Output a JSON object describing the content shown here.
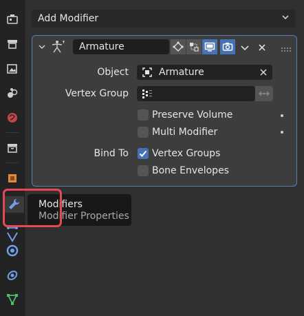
{
  "header": {
    "add_modifier_label": "Add Modifier"
  },
  "modifier": {
    "name": "Armature",
    "object_label": "Object",
    "object_value": "Armature",
    "vertex_group_label": "Vertex Group",
    "vertex_group_value": "",
    "preserve_volume_label": "Preserve Volume",
    "preserve_volume_checked": false,
    "multi_modifier_label": "Multi Modifier",
    "multi_modifier_checked": false,
    "bind_to_label": "Bind To",
    "vertex_groups_label": "Vertex Groups",
    "vertex_groups_checked": true,
    "bone_envelopes_label": "Bone Envelopes",
    "bone_envelopes_checked": false
  },
  "tooltip": {
    "title": "Modifiers",
    "subtitle": "Modifier Properties"
  },
  "tabs": [
    "tool-icon",
    "render-icon",
    "output-icon",
    "view-layer-icon",
    "scene-icon",
    "world-icon",
    "collection-icon",
    "object-icon",
    "modifier-icon",
    "particles-icon",
    "physics-icon",
    "constraints-icon",
    "data-icon"
  ],
  "colors": {
    "accent": "#4772b3",
    "highlight": "#e44a55",
    "panel": "#3d3d3d"
  }
}
